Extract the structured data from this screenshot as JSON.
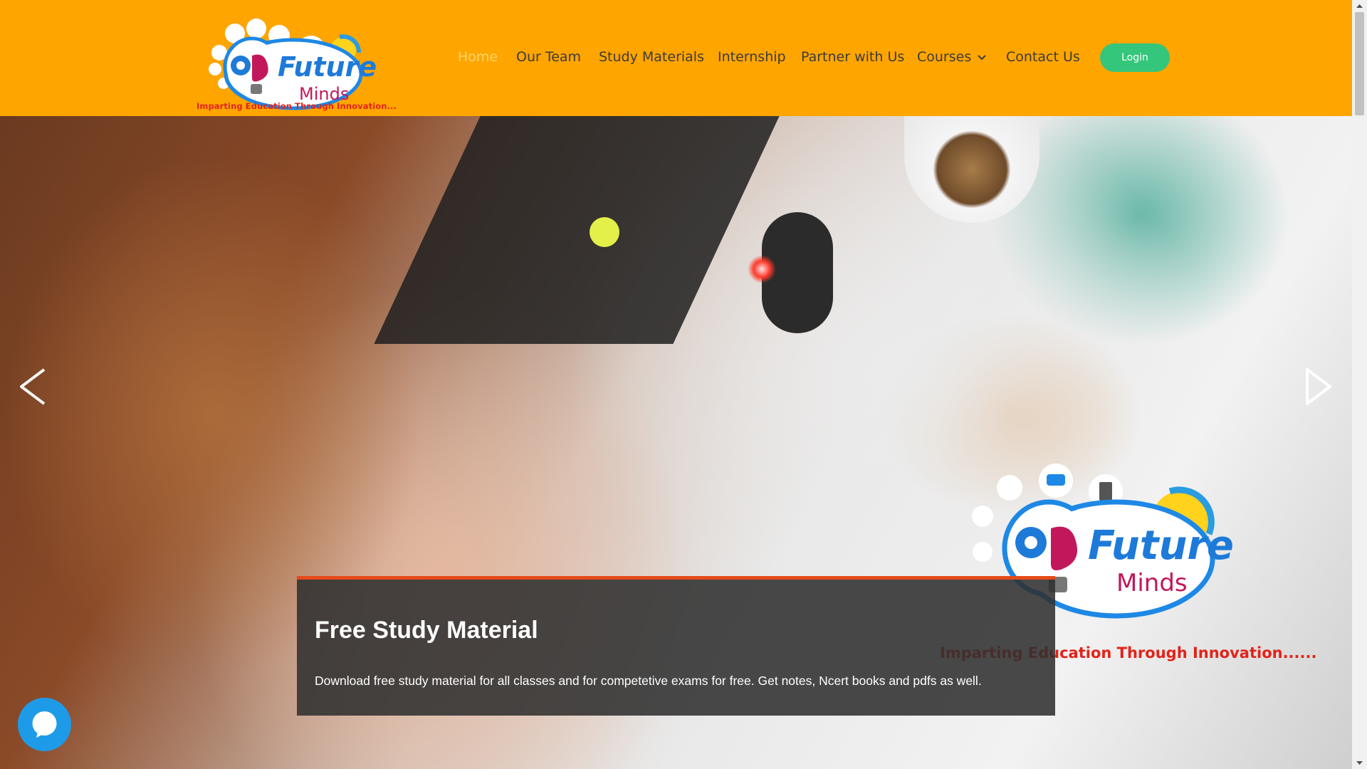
{
  "header": {
    "logo_name": "future-minds-logo",
    "logo_text_top": "Future",
    "logo_text_bottom": "Minds",
    "tagline": "Imparting Education Through Innovation..."
  },
  "nav": {
    "items": [
      {
        "label": "Home",
        "active": true
      },
      {
        "label": "Our Team"
      },
      {
        "label": "Study Materials"
      },
      {
        "label": "Internship"
      },
      {
        "label": "Partner with Us"
      },
      {
        "label": "Courses",
        "has_dropdown": true
      },
      {
        "label": "Contact Us"
      }
    ],
    "login_label": "Login"
  },
  "hero": {
    "logo_text_top": "Future",
    "logo_text_bottom": "Minds",
    "tagline": "Imparting Education Through Innovation......",
    "caption_title": "Free Study Material",
    "caption_text": "Download free study material for all classes and for competetive exams for free. Get notes, Ncert books and pdfs as well."
  },
  "colors": {
    "header_bg": "#ffa500",
    "active_nav": "#ffd76a",
    "login_bg": "#34c67a",
    "caption_accent": "#e64a1a",
    "chat_bg": "#1e9be8",
    "tagline": "#e2231a"
  },
  "icons": [
    "chevron-down-icon",
    "prev-arrow-icon",
    "next-arrow-icon",
    "chat-icon"
  ]
}
